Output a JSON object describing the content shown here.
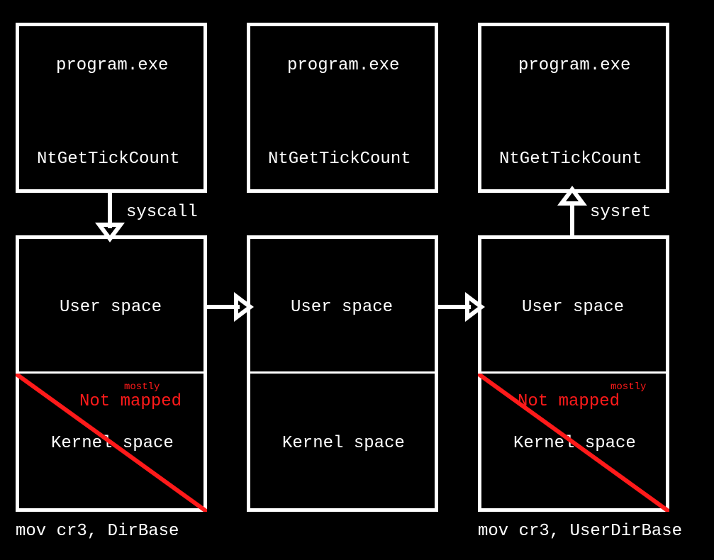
{
  "diagram": {
    "top_boxes": {
      "program_label": "program.exe",
      "api_label": "NtGetTickCount"
    },
    "bottom_boxes": {
      "user_space": "User space",
      "kernel_space": "Kernel space",
      "not_mapped": "Not mapped",
      "mostly": "mostly"
    },
    "arrows": {
      "syscall": "syscall",
      "sysret": "sysret"
    },
    "captions": {
      "left": "mov cr3, DirBase",
      "right": "mov cr3, UserDirBase"
    }
  }
}
